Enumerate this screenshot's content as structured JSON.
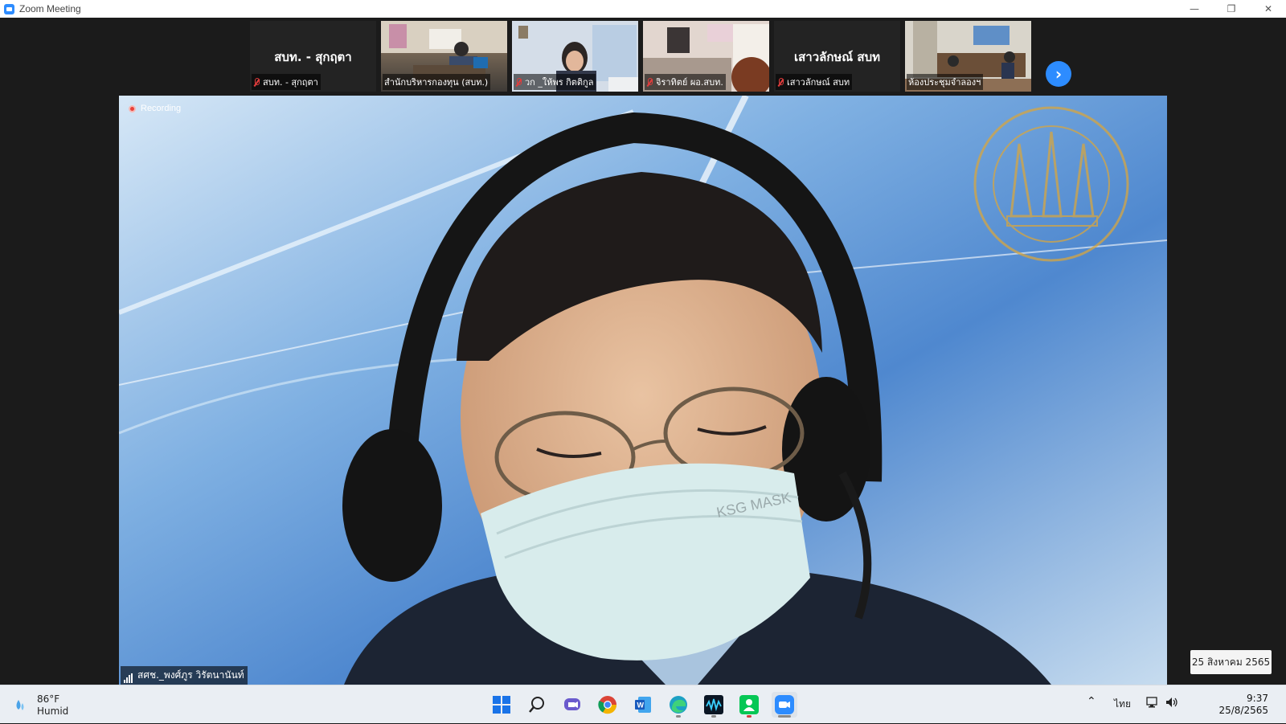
{
  "window": {
    "title": "Zoom Meeting",
    "controls": {
      "minimize": "—",
      "restore": "❐",
      "close": "✕"
    }
  },
  "gallery": {
    "tiles": [
      {
        "big_name": "สบท. - สุกฤตา",
        "label": "สบท. - สุกฤตา",
        "video": false,
        "muted": true
      },
      {
        "label": "สำนักบริหารกองทุน (สบท.)",
        "video": true,
        "muted": false
      },
      {
        "label": "วก _ให้พร กิตติกูล",
        "video": true,
        "muted": true
      },
      {
        "label": "จิราทิตย์ ผอ.สบท.",
        "video": true,
        "muted": true
      },
      {
        "big_name": "เสาวลักษณ์ สบท",
        "label": "เสาวลักษณ์ สบท",
        "video": false,
        "muted": true
      },
      {
        "label": "ห้องประชุมจำลองฯ",
        "video": true,
        "muted": false
      }
    ],
    "next_icon": "›"
  },
  "speaker": {
    "recording_label": "Recording",
    "name": "สศช._พงศ์ภูร วิรัตนานันท์",
    "mask_text": "KSG MASK"
  },
  "date_overlay": "25 สิงหาคม 2565",
  "taskbar": {
    "weather": {
      "temp": "86°F",
      "condition": "Humid"
    },
    "apps": [
      "windows-start",
      "search",
      "teams-chat",
      "chrome",
      "word",
      "edge",
      "waves",
      "line",
      "zoom"
    ],
    "tray": {
      "language": "ไทย"
    },
    "clock": {
      "time": "9:37",
      "date": "25/8/2565"
    }
  },
  "colors": {
    "zoom_blue": "#2d8cff",
    "record_red": "#e8403a",
    "muted_red": "#e03c3c"
  }
}
